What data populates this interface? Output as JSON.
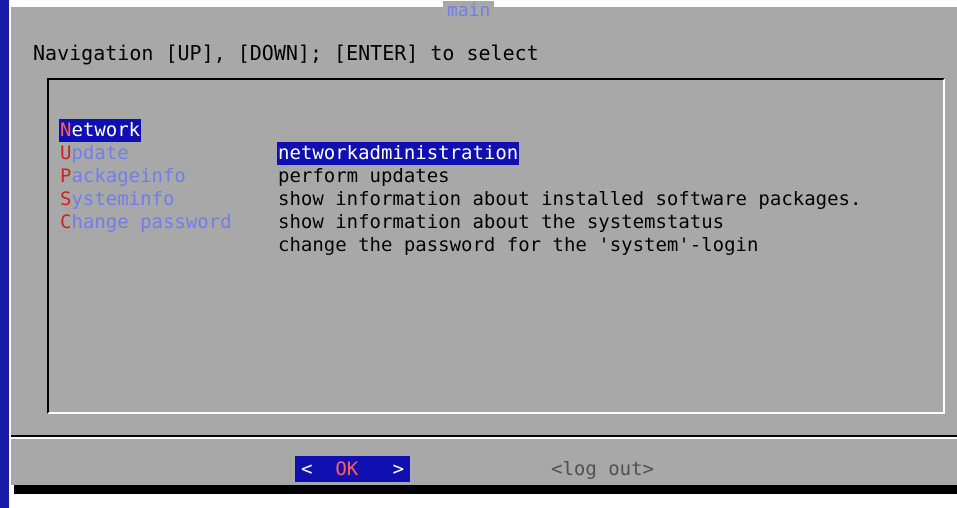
{
  "dialog": {
    "title": "main",
    "prompt": "Navigation [UP], [DOWN]; [ENTER] to select"
  },
  "menu": {
    "items": [
      {
        "hotkey": "N",
        "rest": "etwork",
        "description": "networkadministration",
        "selected": true
      },
      {
        "hotkey": "U",
        "rest": "pdate",
        "description": "perform updates",
        "selected": false
      },
      {
        "hotkey": "P",
        "rest": "ackageinfo",
        "description": "show information about installed software packages.",
        "selected": false
      },
      {
        "hotkey": "S",
        "rest": "ysteminfo",
        "description": "show information about the systemstatus",
        "selected": false
      },
      {
        "hotkey": "C",
        "rest": "hange password",
        "description": "change the password for the 'system'-login",
        "selected": false
      }
    ]
  },
  "buttons": {
    "ok": {
      "left": "<",
      "hot": "OK",
      "right": ">"
    },
    "logout": "<log out>"
  },
  "colors": {
    "selection_bg": "#1010b0",
    "dialog_bg": "#a8a8a8",
    "hotkey": "#d02020",
    "tag_text": "#6f7fe8"
  }
}
